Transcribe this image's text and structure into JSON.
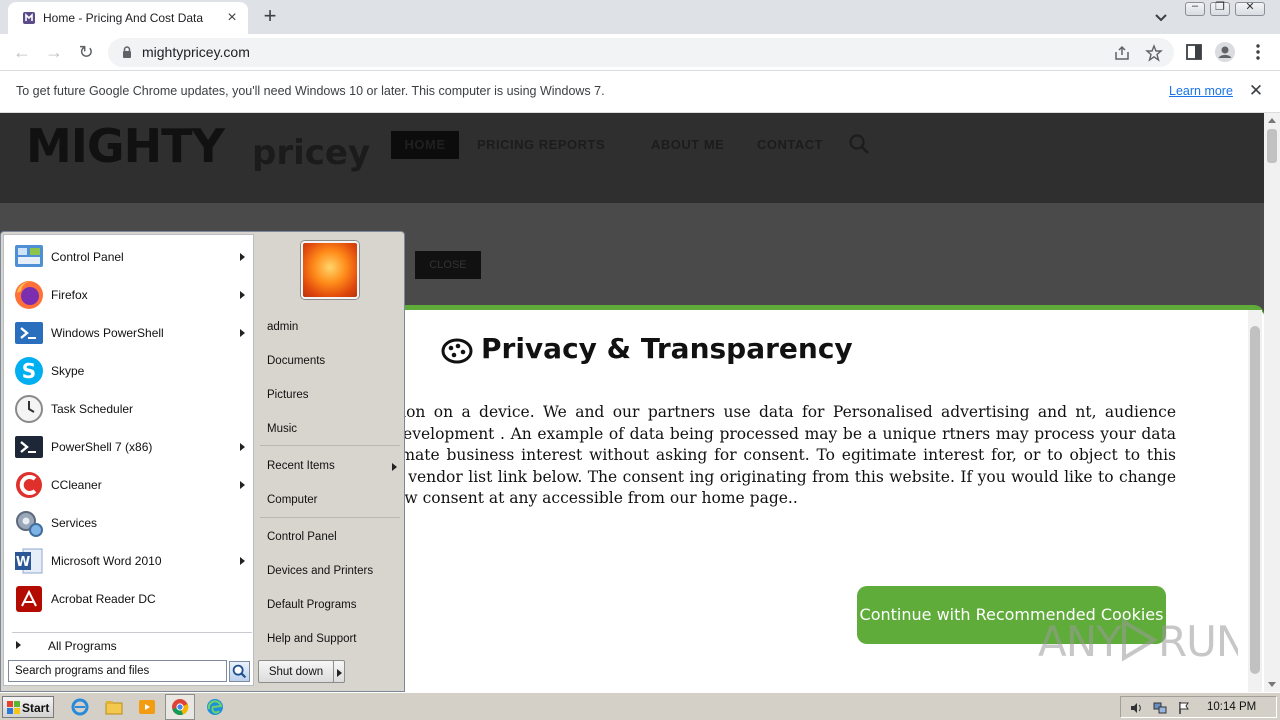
{
  "browser": {
    "tab_title": "Home - Pricing And Cost Data",
    "tab_close": "×",
    "new_tab": "+",
    "url": "mightypricey.com"
  },
  "infobar": {
    "message": "To get future Google Chrome updates, you'll need Windows 10 or later. This computer is using Windows 7.",
    "learn_more": "Learn more",
    "close": "✕"
  },
  "site": {
    "logo_main": "MIGHTY",
    "logo_sub": "pricey",
    "nav": [
      "HOME",
      "PRICING REPORTS",
      "ABOUT ME",
      "CONTACT"
    ],
    "dim_button": "CLOSE"
  },
  "consent": {
    "title": "Privacy & Transparency",
    "body": "and/or access information on a device. We and our partners use data for Personalised advertising and nt, audience research and services development . An example of data being processed may be a unique rtners may process your data as a part of their legitimate business interest without asking for consent. To egitimate interest for, or to object to this data processing use the vendor list link below. The consent ing originating from this website. If you would like to change your settings or withdraw consent at any accessible from our home page..",
    "button": "Continue with Recommended Cookies",
    "accent_color": "#5fac3a"
  },
  "start_menu": {
    "programs": [
      {
        "label": "Control Panel",
        "icon": "control-panel-icon",
        "arrow": true
      },
      {
        "label": "Firefox",
        "icon": "firefox-icon",
        "arrow": true
      },
      {
        "label": "Windows PowerShell",
        "icon": "powershell-icon",
        "arrow": true
      },
      {
        "label": "Skype",
        "icon": "skype-icon",
        "arrow": false
      },
      {
        "label": "Task Scheduler",
        "icon": "task-scheduler-icon",
        "arrow": false
      },
      {
        "label": "PowerShell 7 (x86)",
        "icon": "powershell7-icon",
        "arrow": true
      },
      {
        "label": "CCleaner",
        "icon": "ccleaner-icon",
        "arrow": true
      },
      {
        "label": "Services",
        "icon": "services-icon",
        "arrow": false
      },
      {
        "label": "Microsoft Word 2010",
        "icon": "word-icon",
        "arrow": true
      },
      {
        "label": "Acrobat Reader DC",
        "icon": "acrobat-icon",
        "arrow": false
      }
    ],
    "all_programs": "All Programs",
    "search_placeholder": "Search programs and files",
    "right_items": [
      "admin",
      "Documents",
      "Pictures",
      "Music",
      "Recent Items",
      "Computer",
      "Control Panel",
      "Devices and Printers",
      "Default Programs",
      "Help and Support"
    ],
    "shutdown": "Shut down"
  },
  "taskbar": {
    "start": "Start",
    "clock": "10:14 PM"
  },
  "watermark": "ANY RUN"
}
